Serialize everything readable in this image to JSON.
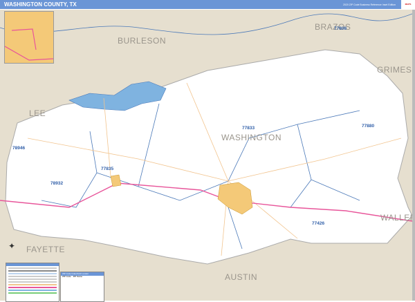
{
  "header": {
    "title": "WASHINGTON COUNTY, TX",
    "subtitle": "2020 ZIP Code Business Reference Inset Edition"
  },
  "colors": {
    "header": "#6a95d6",
    "land": "#e6dfcf",
    "county": "#ffffff",
    "water": "#7fb3e0",
    "city": "#f4c978",
    "highway": "#e8559a",
    "zip_boundary": "#4a78b8"
  },
  "counties": [
    "BURLESON",
    "BRAZOS",
    "GRIMES",
    "LEE",
    "WASHINGTON",
    "FAYETTE",
    "AUSTIN",
    "WALLER"
  ],
  "zips": [
    "77808",
    "77833",
    "77880",
    "77835",
    "78946",
    "78932",
    "77426"
  ],
  "zip_table": {
    "title": "ZIP Code Index/Grid Locator",
    "headers": [
      "ZIP Code",
      "ZIP Name"
    ]
  },
  "icons": [
    "compass-rose-icon",
    "publisher-logo"
  ]
}
